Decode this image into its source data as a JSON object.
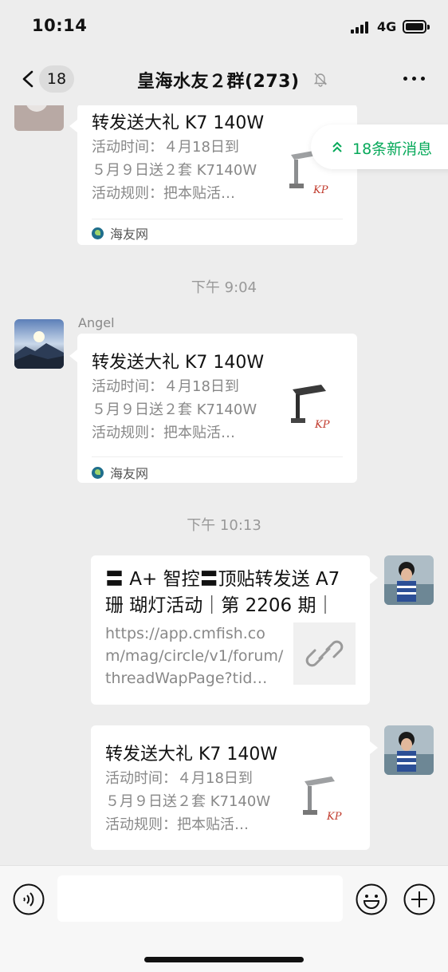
{
  "status_bar": {
    "time": "10:14",
    "network": "4G"
  },
  "header": {
    "back_count": "18",
    "title": "皇海水友２群(273)",
    "icons": [
      "chevron-left-icon",
      "bell-off-icon",
      "more-icon"
    ]
  },
  "new_messages": {
    "label": "18条新消息",
    "icon": "double-chevron-up-icon",
    "color": "#07a95a"
  },
  "messages": [
    {
      "type": "card",
      "side": "left",
      "title": "转发送大礼 K7 140W",
      "desc": [
        "活动时间：４月18日到",
        "５月９日送２套 K7140W",
        "活动规则：把本贴活…"
      ],
      "source": "海友网"
    },
    {
      "type": "timestamp",
      "text": "下午 9:04"
    },
    {
      "type": "card",
      "side": "left",
      "sender": "Angel",
      "title": "转发送大礼 K7 140W",
      "desc": [
        "活动时间：４月18日到",
        "５月９日送２套 K7140W",
        "活动规则：把本贴活…"
      ],
      "source": "海友网"
    },
    {
      "type": "timestamp",
      "text": "下午 10:13"
    },
    {
      "type": "link",
      "side": "right",
      "title": "〓 A+ 智控〓顶贴转发送 A7 珊 瑚灯活动｜第 2206 期｜",
      "url": "https://app.cmfish.com/mag/circle/v1/forum/threadWapPage?tid…"
    },
    {
      "type": "card",
      "side": "right",
      "title": "转发送大礼 K7 140W",
      "desc": [
        "活动时间：４月18日到",
        "５月９日送２套 K7140W",
        "活动规则：把本贴活…"
      ]
    }
  ],
  "input_bar": {
    "icons": [
      "voice-icon",
      "emoji-icon",
      "plus-icon"
    ]
  },
  "colors": {
    "background": "#ededed",
    "bubble": "#ffffff",
    "accent": "#07a95a"
  }
}
